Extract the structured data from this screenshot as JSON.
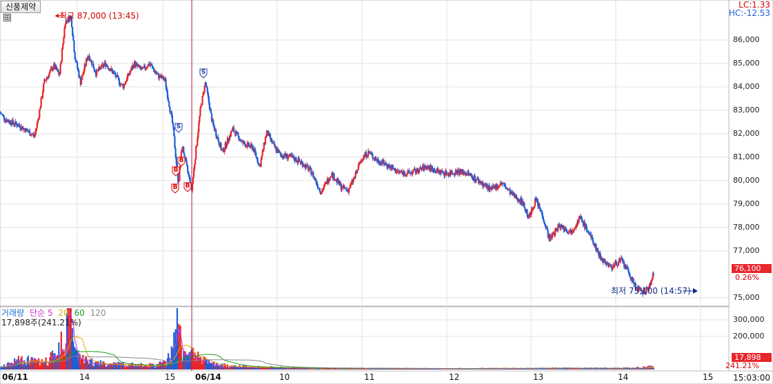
{
  "header": {
    "stock_name": "신풍제약",
    "lc_label": "LC:1.33",
    "hc_label": "HC:-12.53"
  },
  "annotations": {
    "high": "최고 87,000 (13:45)",
    "low": "최저 75,100 (14:57)"
  },
  "current": {
    "price": "76,100",
    "change": "0.26%",
    "volume": "17,898",
    "volume_change": "241.21%",
    "time": "15:03:00"
  },
  "volume_panel": {
    "legend": [
      "거래량",
      "단순",
      "5",
      "20",
      "60",
      "120"
    ],
    "value": "17,898주(241.21%)"
  },
  "colors": {
    "up": "#e8262b",
    "down": "#1f5ed8",
    "ma5": "#cc33cc",
    "ma20": "#e6a800",
    "ma60": "#1e9e1e",
    "ma120": "#888888"
  },
  "trade_markers": {
    "buy": "B",
    "sell": "S"
  },
  "x_axis": {
    "labels": [
      "06/11",
      "14",
      "15",
      "06/14",
      "10",
      "11",
      "12",
      "13",
      "14",
      "15"
    ]
  },
  "chart_data": {
    "type": "candlestick",
    "price_axis": {
      "ticks": [
        "86,000",
        "85,000",
        "84,000",
        "83,000",
        "82,000",
        "81,000",
        "80,000",
        "79,000",
        "78,000",
        "77,000",
        "75,000"
      ],
      "ylim": [
        74700,
        87650
      ]
    },
    "volume_axis": {
      "ticks": [
        "300,000",
        "200,000"
      ],
      "ylim": [
        0,
        370000
      ]
    },
    "price_series": [
      [
        0,
        82900
      ],
      [
        0.03,
        82600
      ],
      [
        0.1,
        82350
      ],
      [
        0.18,
        81900
      ],
      [
        0.2,
        82700
      ],
      [
        0.23,
        84200
      ],
      [
        0.28,
        84900
      ],
      [
        0.31,
        84500
      ],
      [
        0.34,
        86800
      ],
      [
        0.37,
        87000
      ],
      [
        0.39,
        85300
      ],
      [
        0.42,
        84200
      ],
      [
        0.46,
        85400
      ],
      [
        0.5,
        84600
      ],
      [
        0.55,
        85000
      ],
      [
        0.6,
        84500
      ],
      [
        0.64,
        84000
      ],
      [
        0.7,
        85000
      ],
      [
        0.74,
        84700
      ],
      [
        0.78,
        85000
      ],
      [
        0.82,
        84500
      ],
      [
        0.86,
        84300
      ],
      [
        0.9,
        82400
      ],
      [
        0.93,
        79900
      ],
      [
        0.95,
        81500
      ],
      [
        0.97,
        80700
      ],
      [
        1.0,
        79600
      ],
      [
        1.02,
        81000
      ],
      [
        1.05,
        83000
      ],
      [
        1.08,
        84200
      ],
      [
        1.12,
        82500
      ],
      [
        1.18,
        81200
      ],
      [
        1.24,
        82200
      ],
      [
        1.3,
        81600
      ],
      [
        1.36,
        81400
      ],
      [
        1.4,
        80600
      ],
      [
        1.44,
        82100
      ],
      [
        1.48,
        81500
      ],
      [
        1.52,
        81100
      ],
      [
        1.58,
        81000
      ],
      [
        1.64,
        80800
      ],
      [
        1.7,
        80400
      ],
      [
        1.76,
        79500
      ],
      [
        1.82,
        80300
      ],
      [
        1.88,
        79700
      ],
      [
        1.92,
        79600
      ],
      [
        1.96,
        80200
      ],
      [
        2.0,
        81000
      ],
      [
        2.04,
        81200
      ],
      [
        2.08,
        80900
      ],
      [
        2.14,
        80700
      ],
      [
        2.2,
        80400
      ],
      [
        2.26,
        80300
      ],
      [
        2.32,
        80400
      ],
      [
        2.38,
        80600
      ],
      [
        2.44,
        80400
      ],
      [
        2.5,
        80300
      ],
      [
        2.56,
        80400
      ],
      [
        2.62,
        80300
      ],
      [
        2.7,
        79900
      ],
      [
        2.76,
        79600
      ],
      [
        2.82,
        79900
      ],
      [
        2.88,
        79400
      ],
      [
        2.94,
        79100
      ],
      [
        2.98,
        78400
      ],
      [
        3.02,
        79200
      ],
      [
        3.06,
        78500
      ],
      [
        3.1,
        77500
      ],
      [
        3.16,
        78100
      ],
      [
        3.22,
        77800
      ],
      [
        3.28,
        78400
      ],
      [
        3.32,
        77900
      ],
      [
        3.36,
        77300
      ],
      [
        3.4,
        76700
      ],
      [
        3.46,
        76300
      ],
      [
        3.52,
        76600
      ],
      [
        3.56,
        76100
      ],
      [
        3.6,
        75500
      ],
      [
        3.64,
        75200
      ],
      [
        3.68,
        75400
      ],
      [
        3.71,
        76100
      ]
    ],
    "volume_series": [
      [
        0,
        12000
      ],
      [
        0.06,
        40000
      ],
      [
        0.12,
        65000
      ],
      [
        0.2,
        45000
      ],
      [
        0.26,
        70000
      ],
      [
        0.3,
        95000
      ],
      [
        0.34,
        220000
      ],
      [
        0.37,
        330000
      ],
      [
        0.4,
        90000
      ],
      [
        0.46,
        55000
      ],
      [
        0.52,
        40000
      ],
      [
        0.6,
        35000
      ],
      [
        0.7,
        28000
      ],
      [
        0.8,
        26000
      ],
      [
        0.86,
        40000
      ],
      [
        0.9,
        110000
      ],
      [
        0.93,
        310000
      ],
      [
        0.95,
        120000
      ],
      [
        0.97,
        70000
      ],
      [
        1.0,
        95000
      ],
      [
        1.02,
        110000
      ],
      [
        1.06,
        60000
      ],
      [
        1.12,
        35000
      ],
      [
        1.2,
        25000
      ],
      [
        1.3,
        18000
      ],
      [
        1.4,
        15000
      ],
      [
        1.6,
        10000
      ],
      [
        1.8,
        9000
      ],
      [
        2.0,
        8000
      ],
      [
        2.4,
        6000
      ],
      [
        2.8,
        7000
      ],
      [
        3.1,
        9000
      ],
      [
        3.4,
        8000
      ],
      [
        3.6,
        10000
      ],
      [
        3.71,
        17898
      ]
    ]
  }
}
